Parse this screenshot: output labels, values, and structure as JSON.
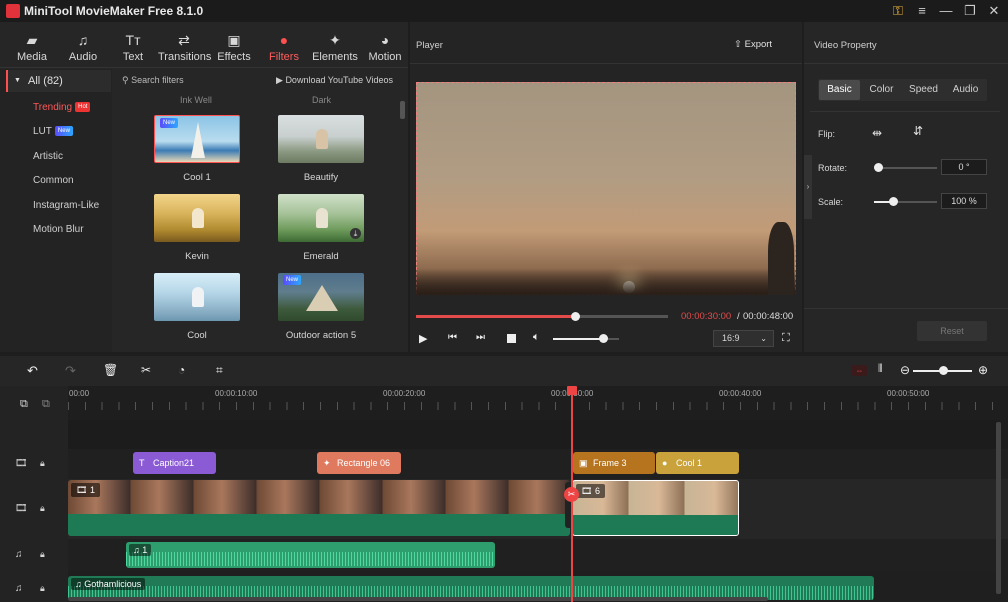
{
  "app": {
    "title": "MiniTool MovieMaker Free 8.1.0"
  },
  "window_controls": [
    "key",
    "menu",
    "minimize",
    "maximize",
    "close"
  ],
  "tool_tabs": [
    {
      "label": "Media",
      "icon": "folder-icon"
    },
    {
      "label": "Audio",
      "icon": "music-icon"
    },
    {
      "label": "Text",
      "icon": "text-icon"
    },
    {
      "label": "Transitions",
      "icon": "transitions-icon"
    },
    {
      "label": "Effects",
      "icon": "effects-icon"
    },
    {
      "label": "Filters",
      "icon": "filters-icon",
      "active": true
    },
    {
      "label": "Elements",
      "icon": "elements-icon"
    },
    {
      "label": "Motion",
      "icon": "motion-icon"
    }
  ],
  "categories": {
    "all": "All (82)",
    "items": [
      {
        "label": "Trending",
        "badge": "Hot",
        "active": true
      },
      {
        "label": "LUT",
        "badge": "New"
      },
      {
        "label": "Artistic"
      },
      {
        "label": "Common"
      },
      {
        "label": "Instagram-Like"
      },
      {
        "label": "Motion Blur"
      }
    ]
  },
  "filters": {
    "search_placeholder": "Search filters",
    "download_link": "Download YouTube Videos",
    "partial_labels": [
      "Ink Well",
      "Dark"
    ],
    "items": [
      {
        "label": "Cool 1",
        "badge": "New",
        "selected": true
      },
      {
        "label": "Beautify"
      },
      {
        "label": "Kevin"
      },
      {
        "label": "Emerald",
        "download": true
      },
      {
        "label": "Cool"
      },
      {
        "label": "Outdoor action 5",
        "badge": "New"
      }
    ]
  },
  "player": {
    "title": "Player",
    "export_label": "Export",
    "current_time": "00:00:30:00",
    "separator": "/",
    "total_time": "00:00:48:00",
    "progress": 0.63,
    "volume": 0.75,
    "aspect_ratio": "16:9"
  },
  "property": {
    "title": "Video Property",
    "tabs": [
      "Basic",
      "Color",
      "Speed",
      "Audio"
    ],
    "active_tab": "Basic",
    "flip_label": "Flip:",
    "rotate_label": "Rotate:",
    "rotate_value": "0 °",
    "rotate_level": 0,
    "scale_label": "Scale:",
    "scale_value": "100 %",
    "scale_level": 0.3,
    "reset_label": "Reset"
  },
  "timeline": {
    "ruler_labels": [
      "00:00",
      "00:00:10:00",
      "00:00:20:00",
      "00:00:30:00",
      "00:00:40:00",
      "00:00:50:00"
    ],
    "zoom_level": 0.5,
    "clips": {
      "caption": "Caption21",
      "rectangle": "Rectangle 06",
      "frame": "Frame 3",
      "filter": "Cool 1",
      "video1": "1",
      "video2": "6",
      "audio1": "1",
      "music": "Gothamlicious"
    }
  },
  "colors": {
    "accent": "#ff4f4f",
    "caption_clip": "#8b5bd6",
    "element_clip": "#e07a5f",
    "frame_clip": "#b7741f",
    "filter_clip": "#c9a23c",
    "audio_clip": "#2f9e6e",
    "playhead": "#e44"
  }
}
